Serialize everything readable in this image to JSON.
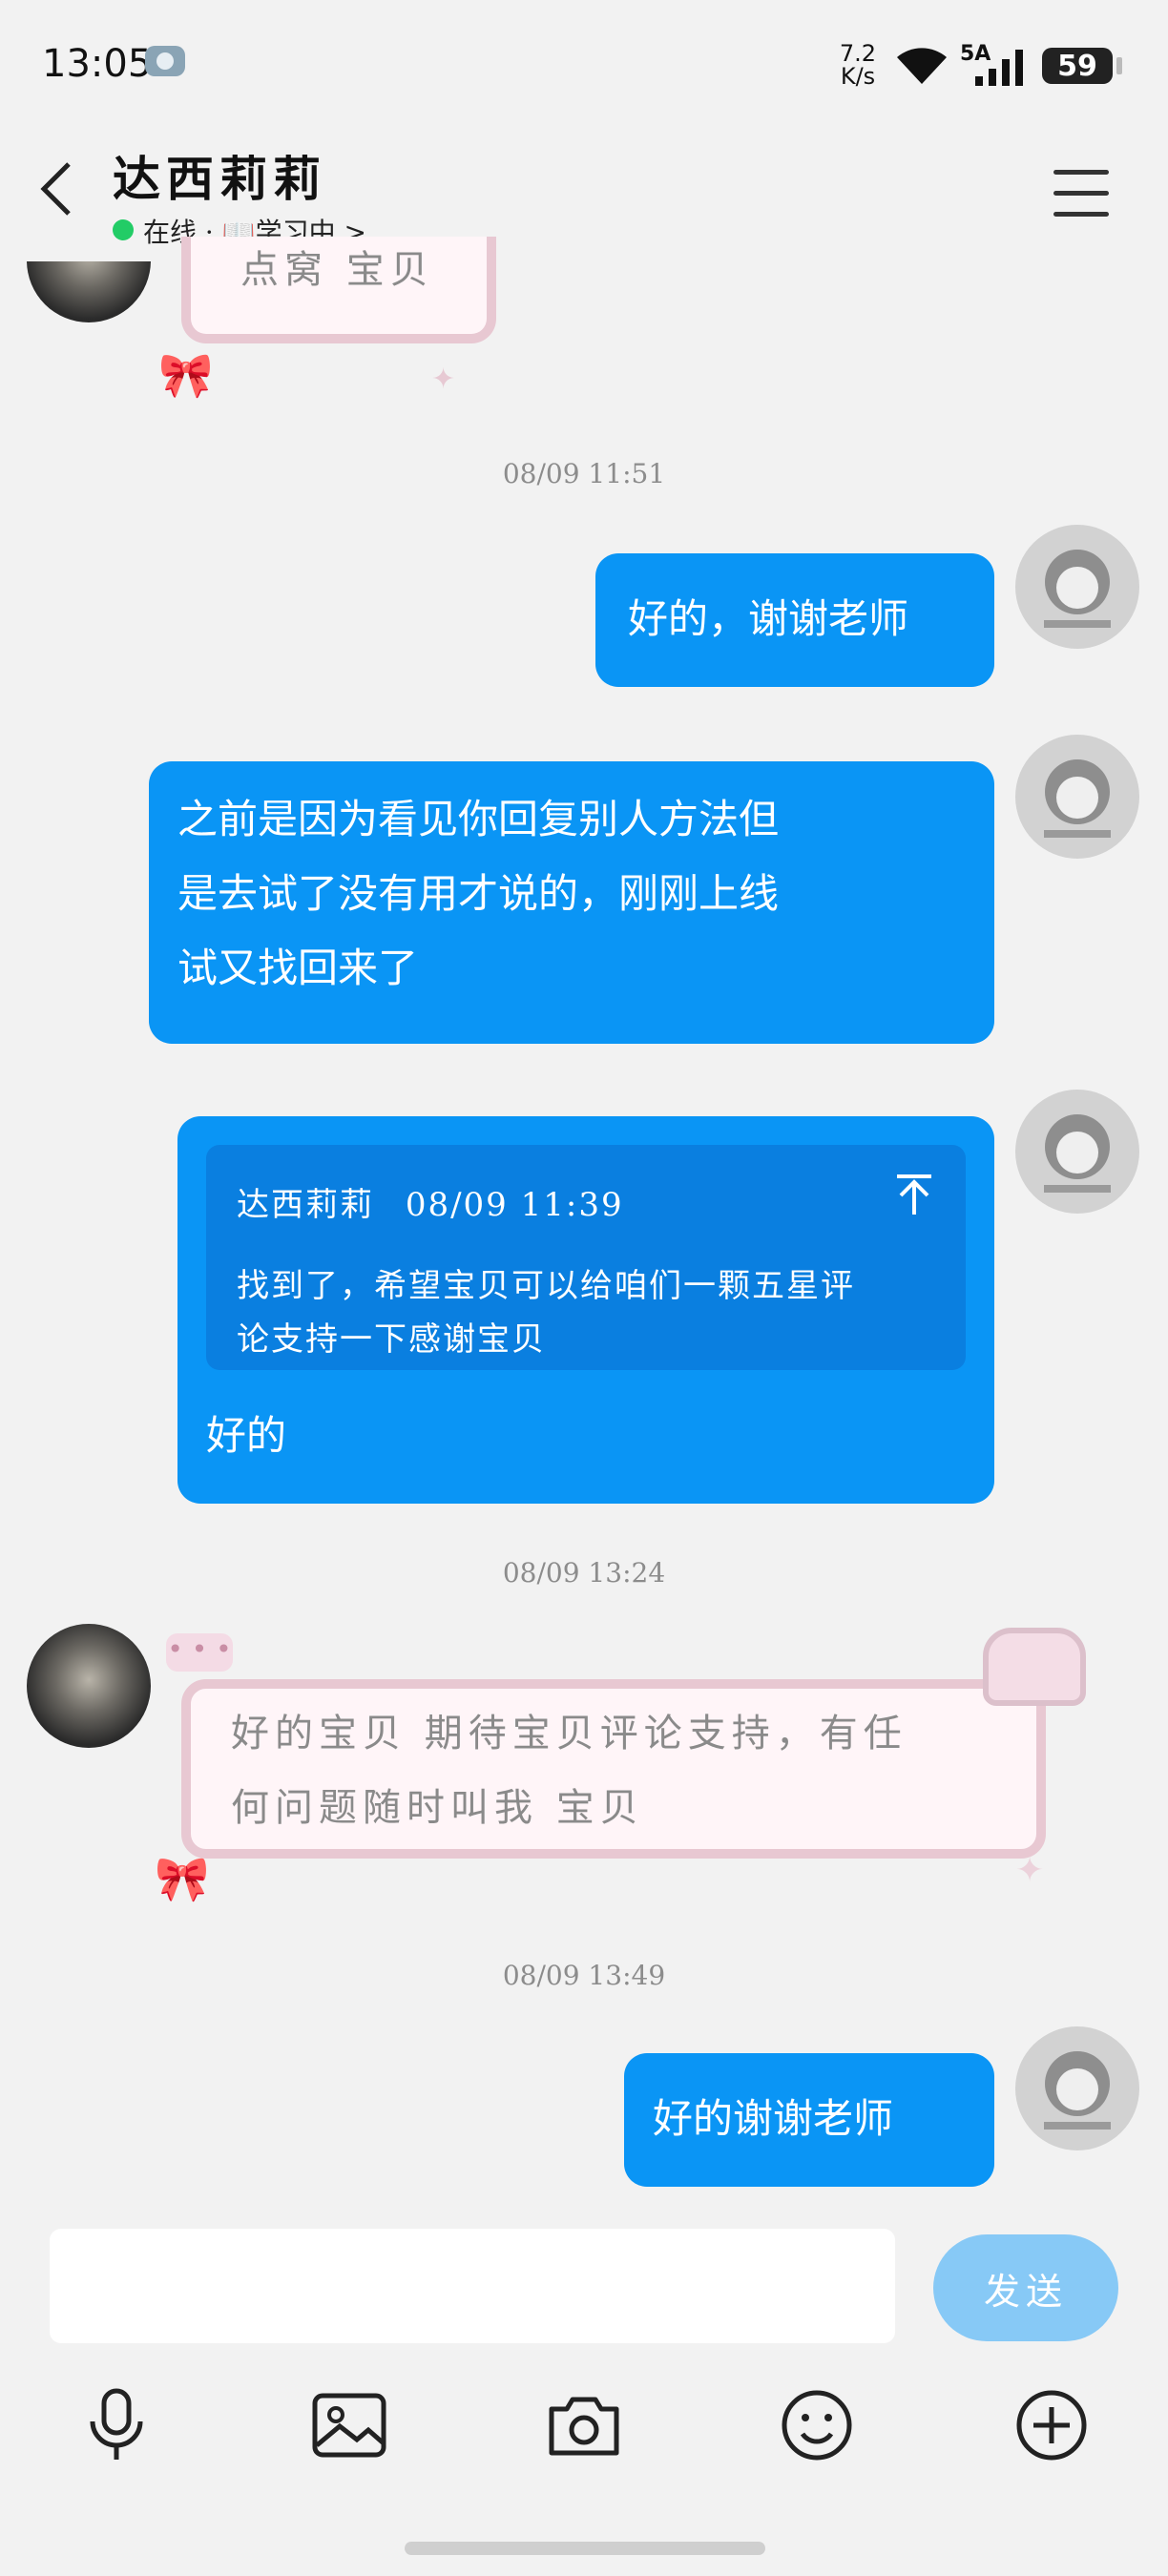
{
  "status_bar": {
    "time": "13:05",
    "net_speed_top": "7.2",
    "net_speed_bottom": "K/s",
    "network": "5A",
    "battery": "59"
  },
  "header": {
    "contact_name": "达西莉莉",
    "status": "在线 · 📖学习中 >",
    "back_icon": "chevron-left-icon",
    "menu_icon": "hamburger-menu-icon"
  },
  "messages": {
    "partial_top_text": "点窝 宝贝",
    "ts1": "08/09 11:51",
    "msg1": "好的，谢谢老师",
    "msg2": {
      "line1": "之前是因为看见你回复别人方法但",
      "line2": "是去试了没有用才说的，刚刚上线",
      "line3": "试又找回来了"
    },
    "msg3": {
      "quote_author": "达西莉莉",
      "quote_time": "08/09 11:39",
      "quote_line1": "找到了，希望宝贝可以给咱们一颗五星评",
      "quote_line2": "论支持一下感谢宝贝",
      "reply": "好的"
    },
    "ts2": "08/09 13:24",
    "msg4": {
      "line1": "好的宝贝 期待宝贝评论支持，有任",
      "line2": "何问题随时叫我  宝贝"
    },
    "ts3": "08/09 13:49",
    "msg5": "好的谢谢老师"
  },
  "input": {
    "placeholder": "",
    "send_label": "发送"
  },
  "toolbar": {
    "icons": [
      "microphone-icon",
      "image-icon",
      "camera-icon",
      "emoji-icon",
      "plus-icon"
    ]
  },
  "colors": {
    "accent": "#0a95f5",
    "send_disabled": "#87c9f6",
    "online": "#22cc66"
  }
}
